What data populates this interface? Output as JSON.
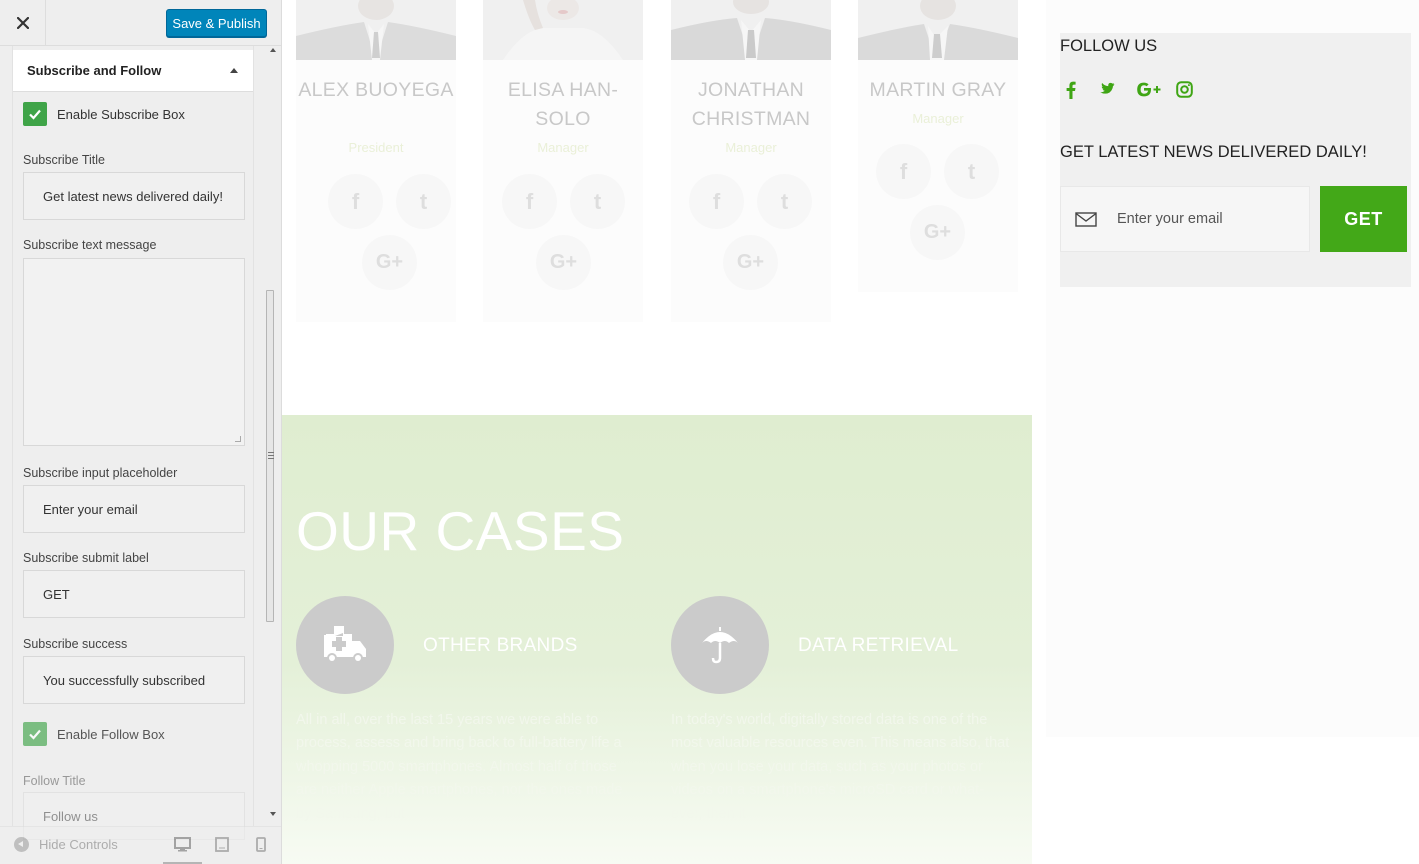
{
  "sidebar": {
    "publish_label": "Save & Publish",
    "section_title": "Subscribe and Follow",
    "enable_subscribe_label": "Enable Subscribe Box",
    "fields": {
      "subscribe_title_label": "Subscribe Title",
      "subscribe_title_value": "Get latest news delivered daily!",
      "subscribe_text_label": "Subscribe text message",
      "subscribe_text_value": "",
      "placeholder_label": "Subscribe input placeholder",
      "placeholder_value": "Enter your email",
      "submit_label": "Subscribe submit label",
      "submit_value": "GET",
      "success_label": "Subscribe success",
      "success_value": "You successfully subscribed"
    },
    "enable_follow_label": "Enable Follow Box",
    "follow_title_label": "Follow Title",
    "follow_title_value": "Follow us",
    "footer": {
      "hide_controls": "Hide Controls"
    }
  },
  "team": [
    {
      "name": "ALEX BUOYEGA",
      "role": "President"
    },
    {
      "name": "ELISA HAN-SOLO",
      "role": "Manager"
    },
    {
      "name": "JONATHAN CHRISTMAN",
      "role": "Manager"
    },
    {
      "name": "MARTIN GRAY",
      "role": "Manager"
    }
  ],
  "cases": {
    "title": "OUR CASES",
    "items": [
      {
        "title": "OTHER BRANDS",
        "text": "All in all, over the last 15 years we were able to process, assess and bring back to full-battery life a whopping 5000 smartphones. Almost half of those are neither Apple smartphones, nor the ones made by Samsung, but"
      },
      {
        "title": "DATA RETRIEVAL",
        "text": "In today's world, digitally stored data is one of the most valuable resources even. This means also, that when you lose your data, such as your photos or videos on a smartphone's microSD card or what-ever, then it"
      }
    ]
  },
  "widget": {
    "follow_title": "FOLLOW US",
    "follow_icons": [
      "facebook-icon",
      "twitter-icon",
      "google-plus-icon",
      "instagram-icon"
    ],
    "news_title": "GET LATEST NEWS DELIVERED DAILY!",
    "email_placeholder": "Enter your email",
    "submit": "GET"
  },
  "colors": {
    "accent_green": "#43a818",
    "publish_blue": "#0085ba",
    "checkbox_green": "#3fa448"
  }
}
